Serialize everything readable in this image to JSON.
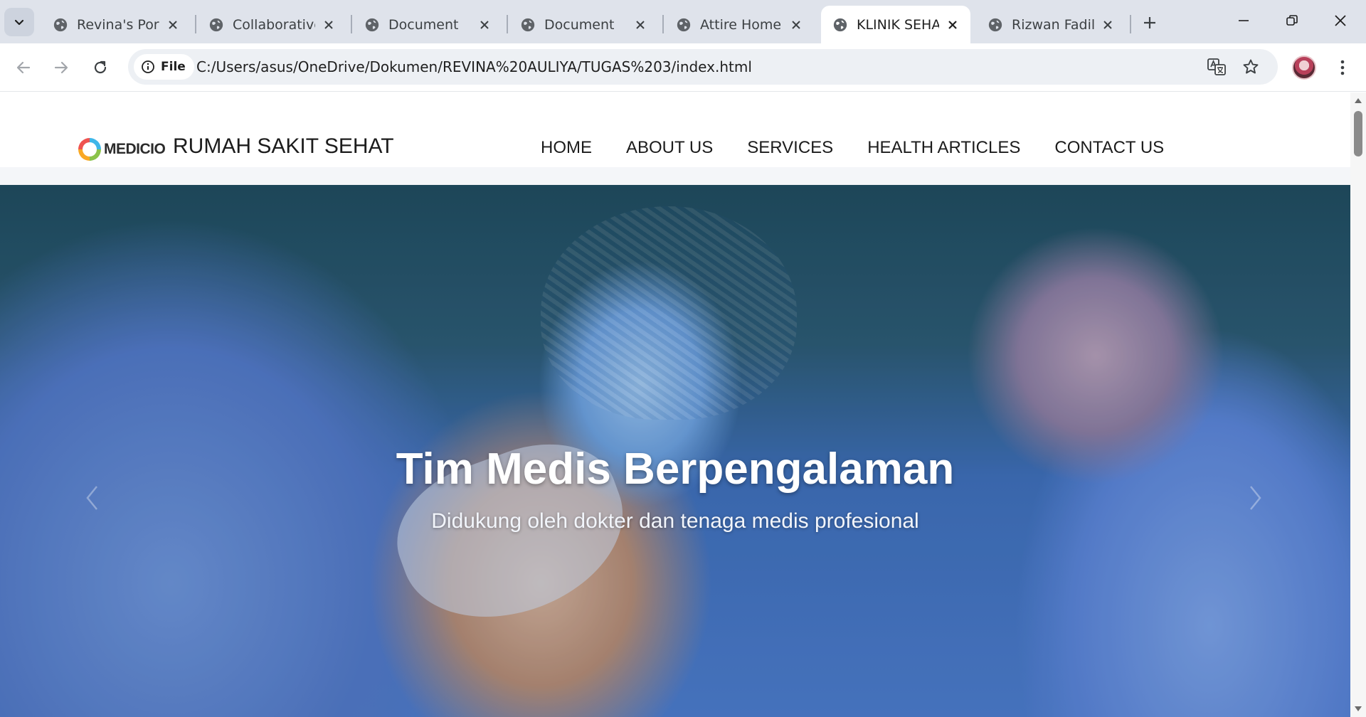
{
  "browser": {
    "tabs": [
      {
        "title": "Revina's Portfo",
        "icon": "globe-icon",
        "active": false
      },
      {
        "title": "Collaborative I",
        "icon": "globe-icon",
        "active": false
      },
      {
        "title": "Document",
        "icon": "globe-icon",
        "active": false
      },
      {
        "title": "Document",
        "icon": "globe-icon",
        "active": false
      },
      {
        "title": "Attire Home",
        "icon": "globe-icon",
        "active": false
      },
      {
        "title": "KLINIK SEHAT",
        "icon": "globe-icon",
        "active": true
      },
      {
        "title": "Rizwan Fadilal",
        "icon": "globe-icon",
        "active": false
      }
    ],
    "address": {
      "scheme_chip": "File",
      "url": "C:/Users/asus/OneDrive/Dokumen/REVINA%20AULIYA/TUGAS%203/index.html"
    }
  },
  "site": {
    "logo_word": "MEDICIO",
    "name": "RUMAH SAKIT SEHAT",
    "nav": [
      {
        "label": "HOME"
      },
      {
        "label": "ABOUT US"
      },
      {
        "label": "SERVICES"
      },
      {
        "label": "HEALTH ARTICLES"
      },
      {
        "label": "CONTACT US"
      }
    ]
  },
  "hero": {
    "title": "Tim Medis Berpengalaman",
    "subtitle": "Didukung oleh dokter dan tenaga medis profesional"
  },
  "colors": {
    "tabstrip_bg": "#dfe3eb",
    "omnibox_bg": "#edf0f4",
    "hero_blue": "#4d7ccb",
    "text_dark": "#1c1c1c"
  }
}
